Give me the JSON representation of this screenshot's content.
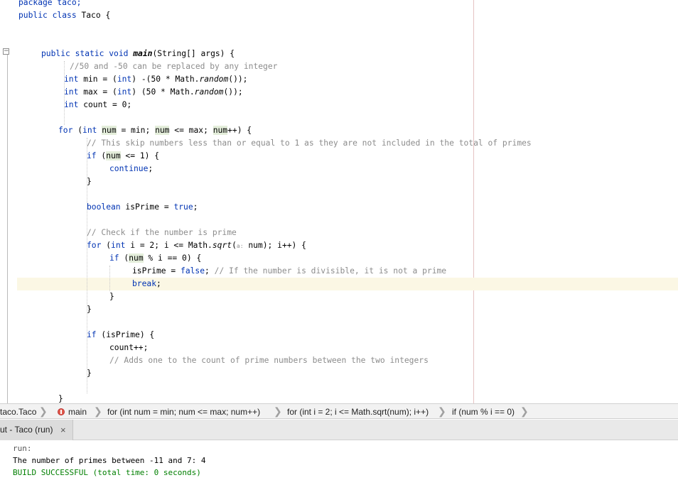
{
  "editor": {
    "line_package": "package taco;",
    "line_class_kw": "public class",
    "line_class_name": "Taco {",
    "line_main_mod": "public static void",
    "line_main_name": "main",
    "line_main_args": "(String[] args) {",
    "comment_50": "//50 and -50 can be replaced by any integer",
    "min_type": "int",
    "min_a": " min = (",
    "min_cast": "int",
    "min_b": ") -(50 * Math.",
    "min_random": "random",
    "min_c": "());",
    "max_type": "int",
    "max_a": " max = (",
    "max_cast": "int",
    "max_b": ") (50 * Math.",
    "max_random": "random",
    "max_c": "());",
    "count_type": "int",
    "count_a": " count = 0;",
    "for1_kw": "for",
    "for1_a": " (",
    "for1_int": "int",
    "for1_num1": "num",
    "for1_b": " = min; ",
    "for1_num2": "num",
    "for1_c": " <= max; ",
    "for1_num3": "num",
    "for1_d": "++) {",
    "comment_skip": "// This skip numbers less than or equal to 1 as they are not included in the total of primes",
    "if1_kw": "if",
    "if1_a": " (",
    "if1_num": "num",
    "if1_b": " <= 1) {",
    "continue_kw": "continue",
    "continue_semi": ";",
    "brace1": "}",
    "bool_type": "boolean",
    "bool_a": " isPrime = ",
    "bool_true": "true",
    "bool_semi": ";",
    "comment_check": "// Check if the number is prime",
    "for2_kw": "for",
    "for2_a": " (",
    "for2_int": "int",
    "for2_b": " i = 2; i <= Math.",
    "for2_sqrt": "sqrt",
    "for2_paren": "(",
    "for2_hint": "a:",
    "for2_c": " num); i++) {",
    "if2_kw": "if",
    "if2_a": " (",
    "if2_num": "num",
    "if2_b": " % i == 0) {",
    "isprime_a": "isPrime = ",
    "isprime_false": "false",
    "isprime_semi": "; ",
    "comment_divisible": "// If the number is divisible, it is not a prime",
    "break_kw": "break",
    "break_semi": ";",
    "brace2": "}",
    "brace3": "}",
    "if3_kw": "if",
    "if3_a": " (isPrime) {",
    "count_inc": "count++;",
    "comment_adds": "// Adds one to the count of prime numbers between the two integers",
    "brace4": "}",
    "brace5": "}",
    "fold_symbol": "−"
  },
  "breadcrumb": {
    "class": "taco.Taco",
    "method": "main",
    "for_outer": "for (int num = min; num <= max; num++)",
    "for_inner": "for (int i = 2; i <= Math.sqrt(num); i++)",
    "if_stmt": "if (num % i == 0)",
    "separator": "❯"
  },
  "output": {
    "tab_label": "ut - Taco (run)",
    "tab_close": "×",
    "lines": {
      "run": "run:",
      "result": "The number of primes between -11 and 7: 4",
      "build": "BUILD SUCCESSFUL (total time: 0 seconds)"
    }
  },
  "colors": {
    "keyword": "#0033b3",
    "comment": "#8c8c8c",
    "highlight": "#e4eedb",
    "caret_row": "#fbf7e4",
    "build_success": "#007f00"
  }
}
